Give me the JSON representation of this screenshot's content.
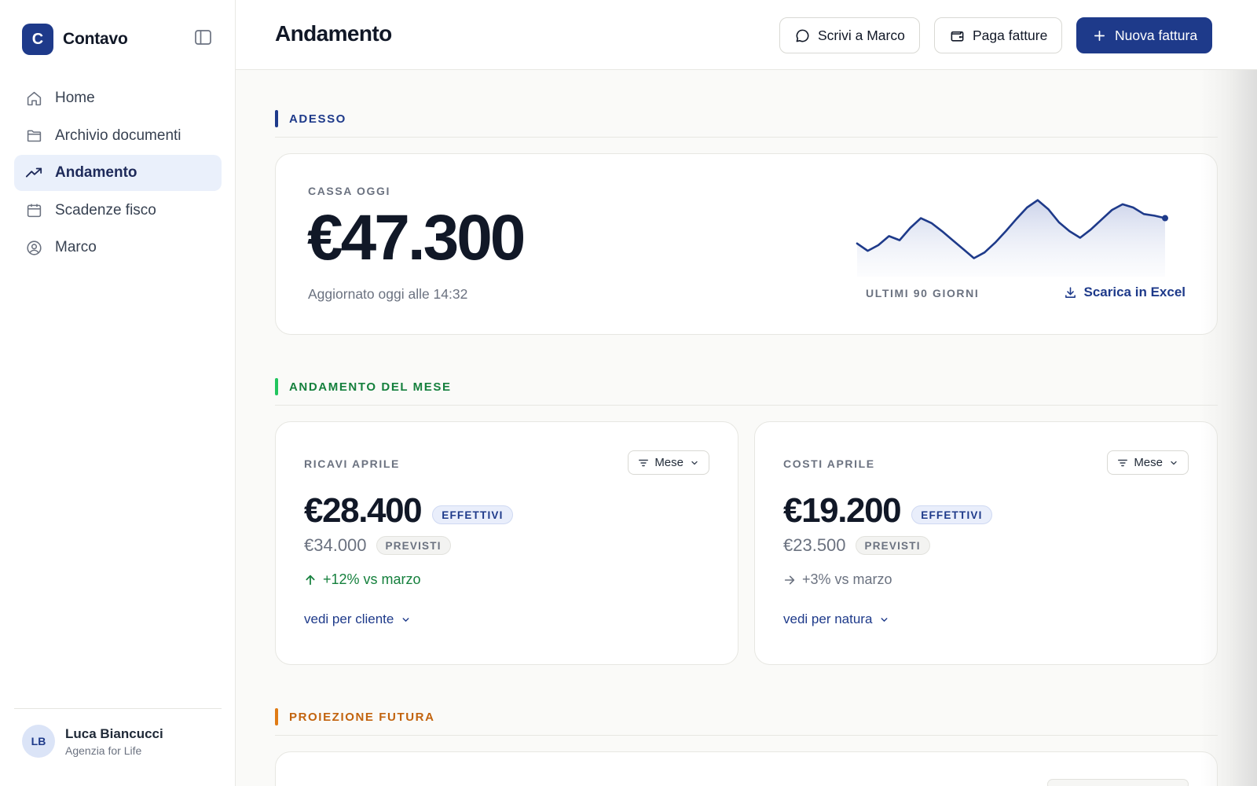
{
  "app": {
    "logo_letter": "C",
    "name": "Contavo"
  },
  "sidebar": {
    "items": [
      {
        "label": "Home",
        "icon": "home-icon"
      },
      {
        "label": "Archivio documenti",
        "icon": "folder-icon"
      },
      {
        "label": "Andamento",
        "icon": "trending-up-icon",
        "active": true
      },
      {
        "label": "Scadenze fisco",
        "icon": "calendar-icon"
      },
      {
        "label": "Marco",
        "icon": "user-circle-icon"
      }
    ],
    "user": {
      "initials": "LB",
      "name": "Luca Biancucci",
      "org": "Agenzia for Life"
    }
  },
  "header": {
    "title": "Andamento",
    "buttons": {
      "message": "Scrivi a Marco",
      "pay": "Paga fatture",
      "new_invoice": "Nuova fattura"
    }
  },
  "sections": {
    "now": {
      "label": "ADESSO",
      "color": "#1e3a8a"
    },
    "month": {
      "label": "ANDAMENTO DEL MESE",
      "color": "#16a34a"
    },
    "future": {
      "label": "PROIEZIONE FUTURA",
      "color": "#c2630e"
    }
  },
  "cash": {
    "eyebrow": "CASSA OGGI",
    "value": "€47.300",
    "updated": "Aggiornato oggi alle 14:32",
    "sparkline_caption": "ULTIMI 90 GIORNI",
    "excel_label": "Scarica in Excel",
    "sparkline_values": [
      31,
      22,
      29,
      40,
      35,
      50,
      62,
      56,
      46,
      35,
      24,
      13,
      20,
      32,
      46,
      61,
      75,
      84,
      73,
      57,
      46,
      38,
      48,
      60,
      72,
      79,
      75,
      67,
      65,
      62
    ]
  },
  "revenue": {
    "eyebrow": "RICAVI APRILE",
    "period": "Mese",
    "value": "€28.400",
    "value_badge": "EFFETTIVI",
    "forecast": "€34.000",
    "forecast_badge": "PREVISTI",
    "delta": "+12% vs marzo",
    "delta_color": "#15803d",
    "drill": "vedi per cliente"
  },
  "costs": {
    "eyebrow": "COSTI APRILE",
    "period": "Mese",
    "value": "€19.200",
    "value_badge": "EFFETTIVI",
    "forecast": "€23.500",
    "forecast_badge": "PREVISTI",
    "delta": "+3% vs marzo",
    "delta_color": "#6b7280",
    "drill": "vedi per natura"
  },
  "colors": {
    "accent": "#1e3a8a",
    "positive": "#15803d",
    "warning": "#c2630e"
  }
}
